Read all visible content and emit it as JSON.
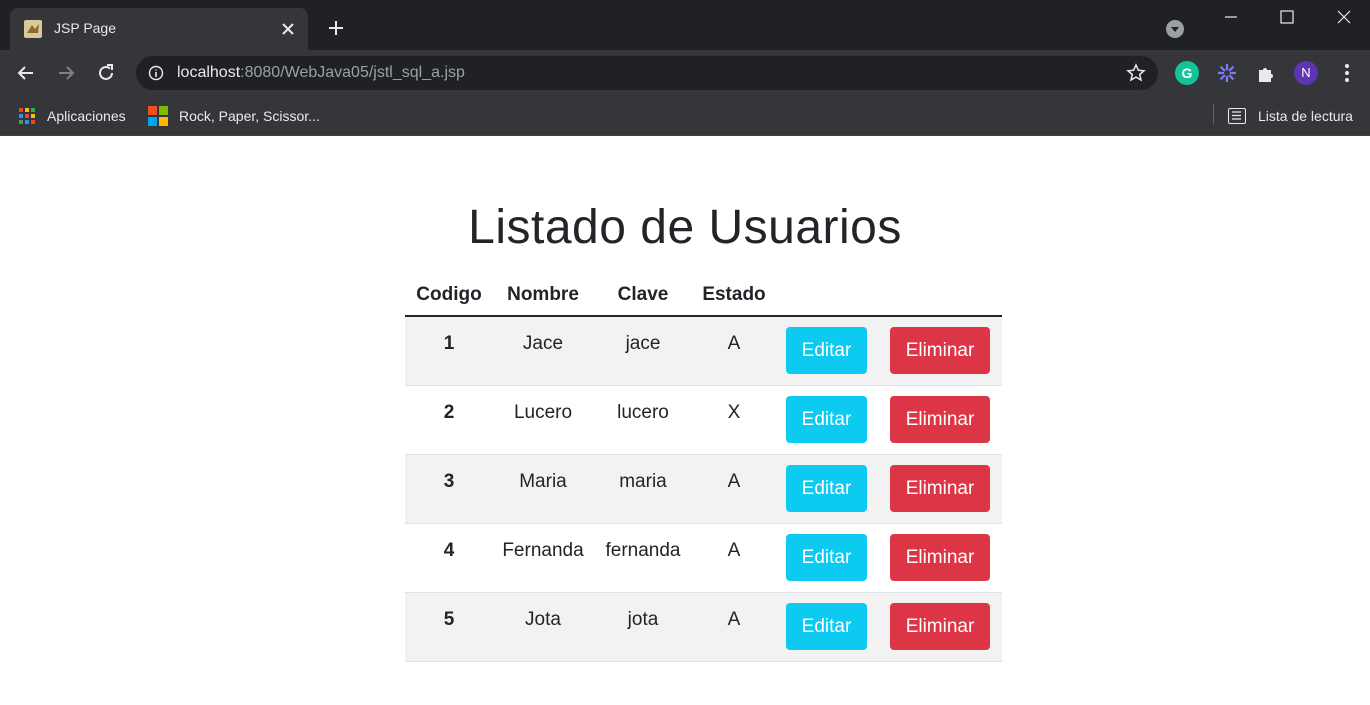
{
  "browser": {
    "tab_title": "JSP Page",
    "url_host": "localhost",
    "url_rest": ":8080/WebJava05/jstl_sql_a.jsp",
    "avatar_letter": "N",
    "grammarly_letter": "G",
    "bookmarks": [
      {
        "label": "Aplicaciones",
        "icon": "apps-grid-icon"
      },
      {
        "label": "Rock, Paper, Scissor...",
        "icon": "microsoft-logo-icon"
      }
    ],
    "reading_list_label": "Lista de lectura"
  },
  "page": {
    "heading": "Listado de Usuarios",
    "columns": [
      "Codigo",
      "Nombre",
      "Clave",
      "Estado"
    ],
    "edit_label": "Editar",
    "delete_label": "Eliminar",
    "rows": [
      {
        "codigo": "1",
        "nombre": "Jace",
        "clave": "jace",
        "estado": "A"
      },
      {
        "codigo": "2",
        "nombre": "Lucero",
        "clave": "lucero",
        "estado": "X"
      },
      {
        "codigo": "3",
        "nombre": "Maria",
        "clave": "maria",
        "estado": "A"
      },
      {
        "codigo": "4",
        "nombre": "Fernanda",
        "clave": "fernanda",
        "estado": "A"
      },
      {
        "codigo": "5",
        "nombre": "Jota",
        "clave": "jota",
        "estado": "A"
      }
    ]
  },
  "colors": {
    "edit_button": "#0dcaf0",
    "delete_button": "#dc3545",
    "stripe": "#f2f2f2"
  }
}
